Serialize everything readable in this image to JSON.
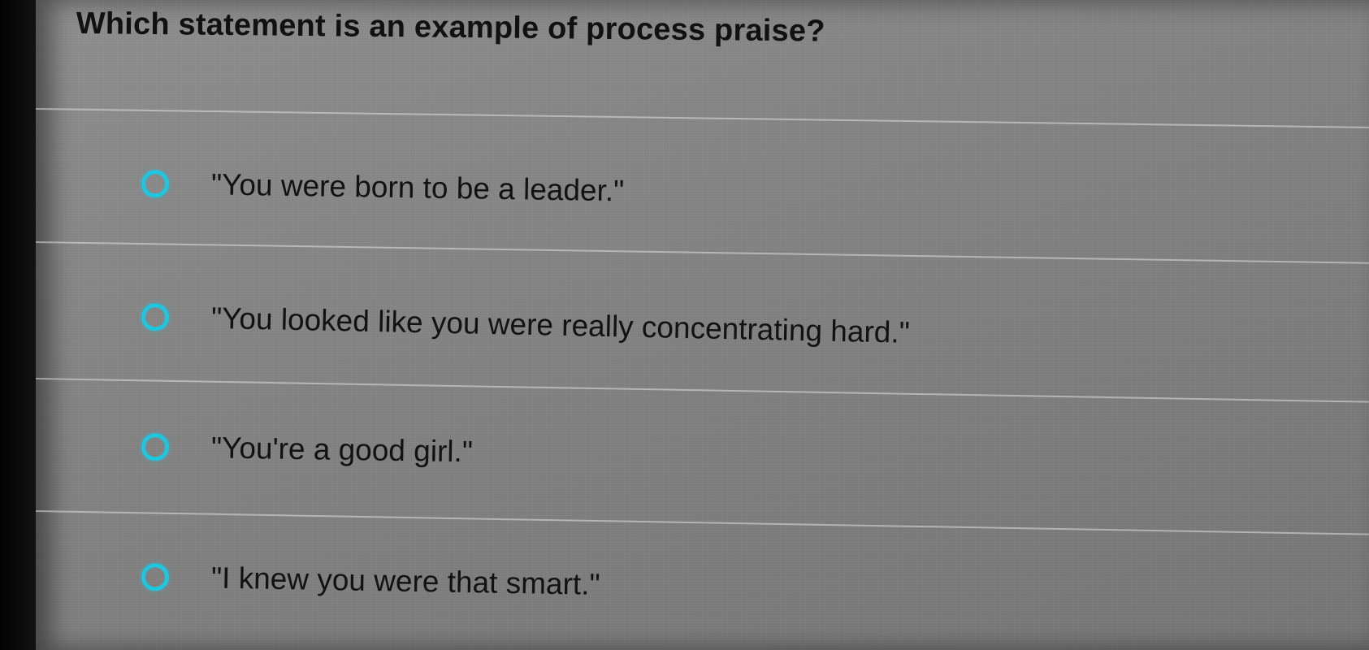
{
  "question": {
    "text": "Which statement is an example of process praise?"
  },
  "options": [
    {
      "label": "\"You were born to be a leader.\"",
      "selected": false
    },
    {
      "label": "\"You looked like you were really concentrating hard.\"",
      "selected": false
    },
    {
      "label": "\"You're a good girl.\"",
      "selected": false
    },
    {
      "label": "\"I knew you were that smart.\"",
      "selected": false
    }
  ],
  "colors": {
    "radio_ring": "#1ec6e0",
    "background": "#858585",
    "text": "#121212"
  }
}
